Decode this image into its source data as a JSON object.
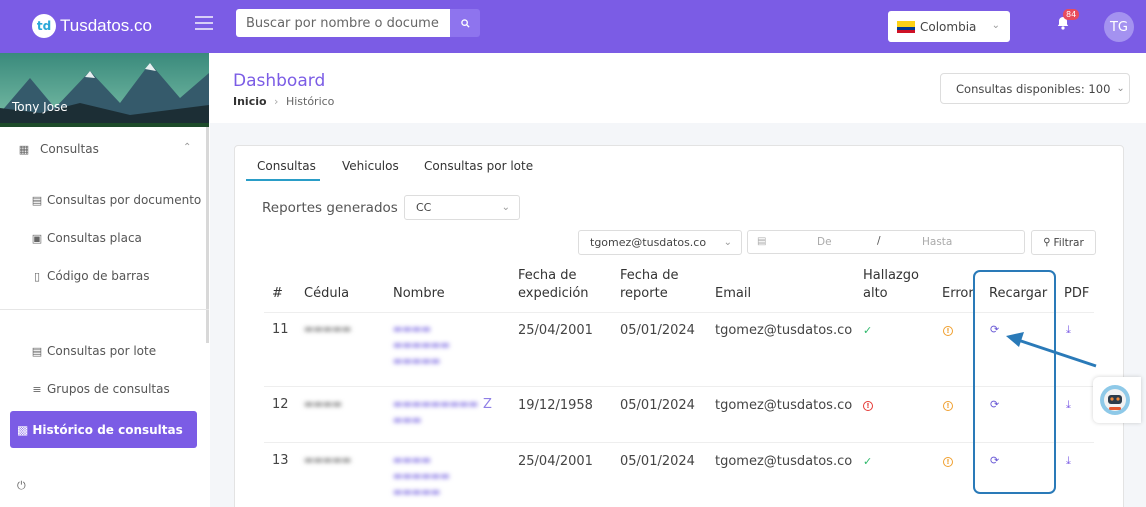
{
  "topbar": {
    "logo_text": "Tusdatos.co",
    "logo_mark": "td",
    "search_placeholder": "Buscar por nombre o documento",
    "country": "Colombia",
    "notifications_count": "84",
    "user_initials": "TG",
    "color": "#7b5ce5"
  },
  "sidebar": {
    "user_name": "Tony Jose",
    "section": "Consultas",
    "items": [
      {
        "label": "Consultas por documento",
        "icon": "id-card-icon"
      },
      {
        "label": "Consultas placa",
        "icon": "car-icon"
      },
      {
        "label": "Código de barras",
        "icon": "barcode-icon"
      },
      {
        "label": "Consultas por lote",
        "icon": "id-card-icon"
      },
      {
        "label": "Grupos de consultas",
        "icon": "layers-icon"
      }
    ],
    "active_item": "Histórico de consultas",
    "logout_icon": "power-icon"
  },
  "header": {
    "title": "Dashboard",
    "breadcrumb_home": "Inicio",
    "breadcrumb_current": "Histórico",
    "available": "Consultas disponibles: 100"
  },
  "tabs": [
    "Consultas",
    "Vehiculos",
    "Consultas por lote"
  ],
  "filters": {
    "reports_label": "Reportes generados",
    "doc_type": "CC",
    "email": "tgomez@tusdatos.co",
    "date_from": "De",
    "date_sep": "/",
    "date_to": "Hasta",
    "filter_button": "Filtrar"
  },
  "table": {
    "headers": {
      "num": "#",
      "cedula": "Cédula",
      "nombre": "Nombre",
      "fecha_exp_1": "Fecha de",
      "fecha_exp_2": "expedición",
      "fecha_rep_1": "Fecha de",
      "fecha_rep_2": "reporte",
      "email": "Email",
      "hallazgo_1": "Hallazgo",
      "hallazgo_2": "alto",
      "error": "Error",
      "recargar": "Recargar",
      "pdf": "PDF"
    },
    "rows": [
      {
        "num": "11",
        "fecha_exp": "25/04/2001",
        "fecha_rep": "05/01/2024",
        "email": "tgomez@tusdatos.co",
        "hallazgo": "check"
      },
      {
        "num": "12",
        "fecha_exp": "19/12/1958",
        "fecha_rep": "05/01/2024",
        "email": "tgomez@tusdatos.co",
        "hallazgo": "alert"
      },
      {
        "num": "13",
        "fecha_exp": "25/04/2001",
        "fecha_rep": "05/01/2024",
        "email": "tgomez@tusdatos.co",
        "hallazgo": "check"
      }
    ],
    "name_visible_fragment": "Z"
  }
}
